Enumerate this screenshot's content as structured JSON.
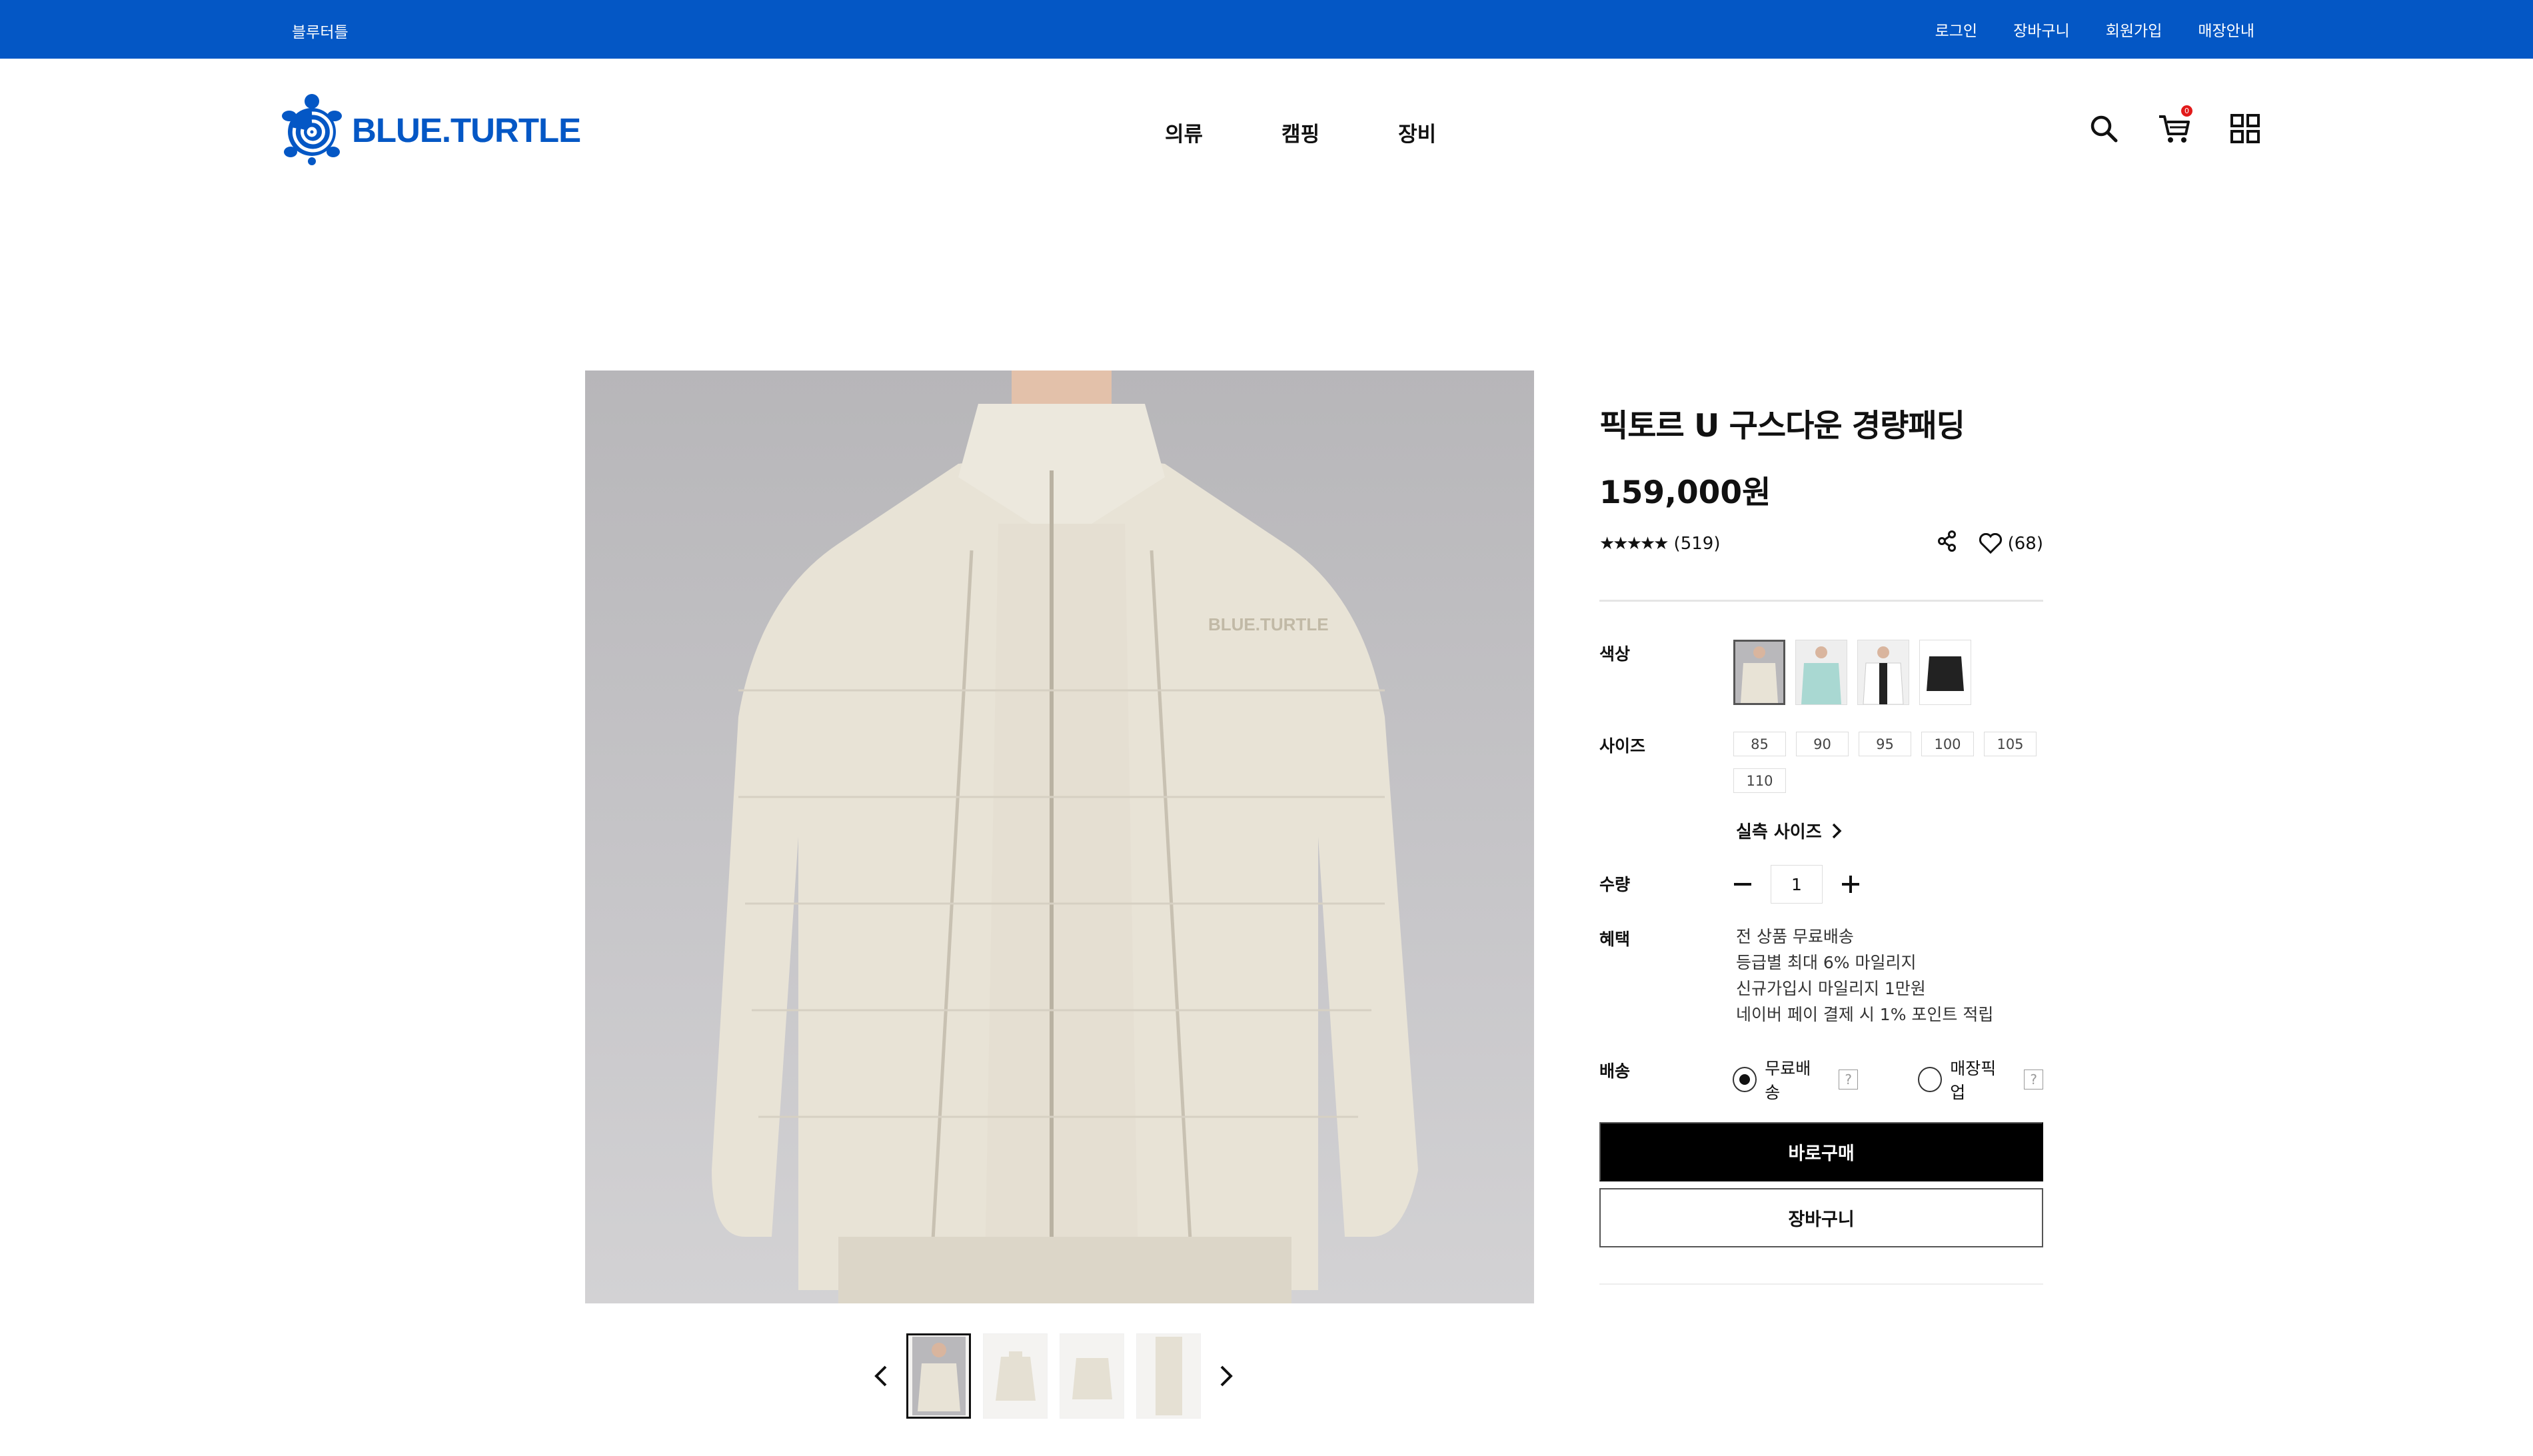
{
  "topbar": {
    "brand": "블루터틀",
    "links": [
      "로그인",
      "장바구니",
      "회원가입",
      "매장안내"
    ]
  },
  "header": {
    "logo_text": "BLUE.TURTLE",
    "nav": [
      "의류",
      "캠핑",
      "장비"
    ],
    "cart_count": "0",
    "icons": [
      "search-icon",
      "cart-icon",
      "grid-menu-icon"
    ]
  },
  "gallery": {
    "thumbs": [
      "model-front",
      "jacket-front",
      "jacket-back",
      "jacket-side"
    ],
    "active_index": 0,
    "prev": "‹",
    "next": "›"
  },
  "product": {
    "title": "픽토르 U 구스다운 경량패딩",
    "price": "159,000원",
    "stars": "★★★★★",
    "review_count": "(519)",
    "like_count": "(68)",
    "labels": {
      "color": "색상",
      "size": "사이즈",
      "qty": "수량",
      "benefit": "혜택",
      "shipping": "배송"
    },
    "colors": [
      "beige",
      "mint",
      "white",
      "black"
    ],
    "sizes": [
      "85",
      "90",
      "95",
      "100",
      "105",
      "110"
    ],
    "real_size": "실측 사이즈",
    "qty_value": "1",
    "benefits": [
      "전 상품 무료배송",
      "등급별 최대 6% 마일리지",
      "신규가입시 마일리지 1만원",
      "네이버 페이 결제 시 1% 포인트 적립"
    ],
    "shipping_options": [
      {
        "label": "무료배송",
        "selected": true
      },
      {
        "label": "매장픽업",
        "selected": false
      }
    ],
    "help": "?",
    "buy_label": "바로구매",
    "cart_label": "장바구니"
  },
  "colors": {
    "brand_blue": "#0457c5",
    "buy_bg": "#000000",
    "badge_red": "#e21a1a"
  }
}
